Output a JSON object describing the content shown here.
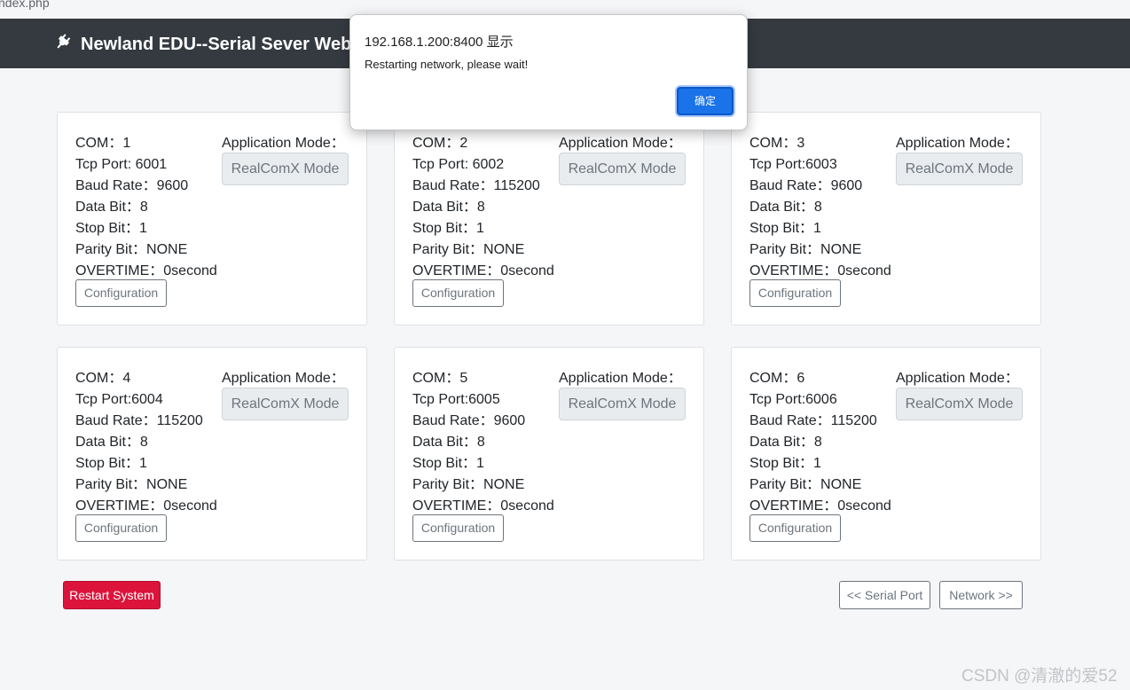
{
  "browser": {
    "url_fragment": "ndex.php"
  },
  "header": {
    "title": "Newland EDU--Serial Sever Web",
    "icon": "plug-icon"
  },
  "ports": [
    {
      "com": "COM：1",
      "tcp": "Tcp Port: 6001",
      "baud": "Baud Rate：9600",
      "data_bit": "Data Bit：8",
      "stop_bit": "Stop Bit：1",
      "parity": "Parity Bit：NONE",
      "overtime": "OVERTIME：0second",
      "mode_label": "Application Mode：",
      "mode_value": "RealComX Mode",
      "config_label": "Configuration"
    },
    {
      "com": "COM：2",
      "tcp": "Tcp Port: 6002",
      "baud": "Baud Rate：115200",
      "data_bit": "Data Bit：8",
      "stop_bit": "Stop Bit：1",
      "parity": "Parity Bit：NONE",
      "overtime": "OVERTIME：0second",
      "mode_label": "Application Mode：",
      "mode_value": "RealComX Mode",
      "config_label": "Configuration"
    },
    {
      "com": "COM：3",
      "tcp": "Tcp Port:6003",
      "baud": "Baud Rate：9600",
      "data_bit": "Data Bit：8",
      "stop_bit": "Stop Bit：1",
      "parity": "Parity Bit：NONE",
      "overtime": "OVERTIME：0second",
      "mode_label": "Application Mode：",
      "mode_value": "RealComX Mode",
      "config_label": "Configuration"
    },
    {
      "com": "COM：4",
      "tcp": "Tcp Port:6004",
      "baud": "Baud Rate：115200",
      "data_bit": "Data Bit：8",
      "stop_bit": "Stop Bit：1",
      "parity": "Parity Bit：NONE",
      "overtime": "OVERTIME：0second",
      "mode_label": "Application Mode：",
      "mode_value": "RealComX Mode",
      "config_label": "Configuration"
    },
    {
      "com": "COM：5",
      "tcp": "Tcp Port:6005",
      "baud": "Baud Rate：9600",
      "data_bit": "Data Bit：8",
      "stop_bit": "Stop Bit：1",
      "parity": "Parity Bit：NONE",
      "overtime": "OVERTIME：0second",
      "mode_label": "Application Mode：",
      "mode_value": "RealComX Mode",
      "config_label": "Configuration"
    },
    {
      "com": "COM：6",
      "tcp": "Tcp Port:6006",
      "baud": "Baud Rate：115200",
      "data_bit": "Data Bit：8",
      "stop_bit": "Stop Bit：1",
      "parity": "Parity Bit：NONE",
      "overtime": "OVERTIME：0second",
      "mode_label": "Application Mode：",
      "mode_value": "RealComX Mode",
      "config_label": "Configuration"
    }
  ],
  "actions": {
    "restart_label": "Restart System",
    "prev_label": "<< Serial Port",
    "next_label": "Network >>"
  },
  "dialog": {
    "title": "192.168.1.200:8400 显示",
    "message": "Restarting network, please wait!",
    "ok_label": "确定"
  },
  "watermark": "CSDN @清澈的爱52",
  "colors": {
    "navbar": "#343a40",
    "danger": "#dc143c",
    "dialog_button": "#1a73e8",
    "background": "#f5f6f8"
  }
}
